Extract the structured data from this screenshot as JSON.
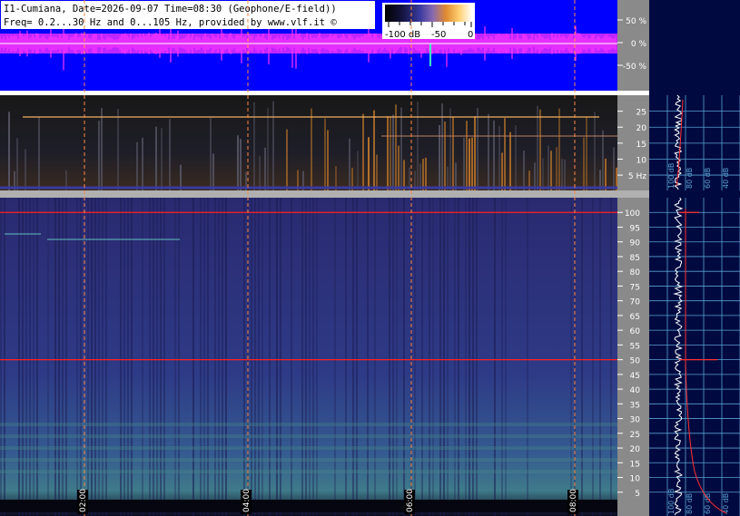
{
  "header": {
    "line1": "I1-Cumiana, Date=2026-09-07 Time=08:30 (Geophone/E-field))",
    "line2": "Freq= 0.2...30 Hz and 0...105 Hz, provided by www.vlf.it ©"
  },
  "colorbar": {
    "labels": [
      "-100 dB",
      "-50",
      "0"
    ],
    "stops": [
      "#000000",
      "#1a1a4a",
      "#4a3fa0",
      "#9a6aa0",
      "#e08a30",
      "#ffd070",
      "#ffffff"
    ]
  },
  "colors": {
    "waveform_bg": "#0000ff",
    "waveform_trace": "#ff33ff",
    "panel_gray": "#8a8a8a",
    "right_panel_bg": "#000a40",
    "grid_line": "#5aa0d0",
    "time_marker": "#ff8844",
    "line_red": "#ff2020",
    "spectrum_white": "#ffffff",
    "spectrum_red": "#ff3030"
  },
  "chart_data": [
    {
      "type": "line",
      "title": "",
      "ylabel": "",
      "y_ticks": [
        "50 %",
        "0 %",
        "-50 %"
      ],
      "y_values": [
        50,
        0,
        -50
      ]
    },
    {
      "type": "heatmap",
      "ylabel": "",
      "ylim": [
        0.2,
        30
      ],
      "y_ticks": [
        "25",
        "20",
        "15",
        "10",
        "5 Hz"
      ],
      "y_values": [
        25,
        20,
        15,
        10,
        5
      ],
      "spectrum_x_ticks": [
        "100 dB",
        "80 dB",
        "60 dB",
        "40 dB",
        "20 dB"
      ]
    },
    {
      "type": "heatmap",
      "ylabel": "",
      "ylim": [
        0,
        105
      ],
      "y_ticks": [
        "100",
        "95",
        "90",
        "85",
        "80",
        "75",
        "70",
        "65",
        "60",
        "55",
        "50",
        "45",
        "40",
        "35",
        "30",
        "25",
        "20",
        "15",
        "10",
        "5"
      ],
      "y_values": [
        100,
        95,
        90,
        85,
        80,
        75,
        70,
        65,
        60,
        55,
        50,
        45,
        40,
        35,
        30,
        25,
        20,
        15,
        10,
        5
      ],
      "x_ticks": [
        "02:00",
        "04:00",
        "06:00",
        "08:00"
      ],
      "x_values": [
        2,
        4,
        6,
        8
      ],
      "spectrum_x_ticks": [
        "100 dB",
        "80 dB",
        "60 dB",
        "40 dB",
        "20 dB"
      ],
      "horizontal_lines_hz": [
        100,
        50
      ]
    }
  ]
}
